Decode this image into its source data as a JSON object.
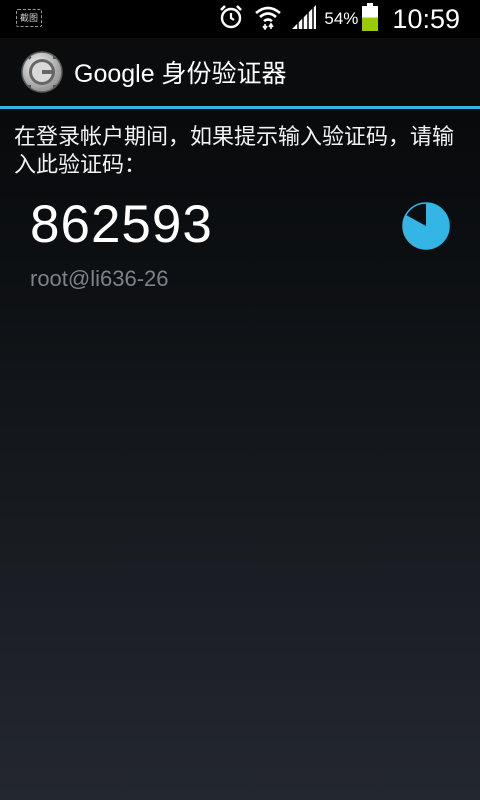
{
  "status_bar": {
    "screenshot_label": "截图",
    "battery_percent": "54%",
    "battery_level": 0.54,
    "time": "10:59",
    "icons": [
      "screenshot-icon",
      "alarm-icon",
      "wifi-icon",
      "signal-icon",
      "battery-icon"
    ]
  },
  "action_bar": {
    "title": "Google 身份验证器",
    "icon": "authenticator-logo-icon"
  },
  "main": {
    "instructions": "在登录帐户期间，如果提示输入验证码，请输入此验证码：",
    "accounts": [
      {
        "code": "862593",
        "account": "root@li636-26",
        "timer_remaining_fraction": 0.83
      }
    ]
  },
  "colors": {
    "accent": "#33b5e5",
    "account_text": "#7e8389",
    "battery_fill": "#9c0"
  }
}
